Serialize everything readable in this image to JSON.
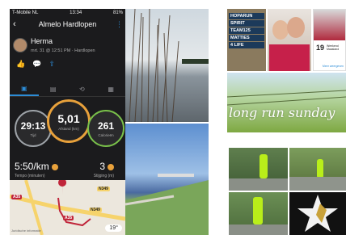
{
  "phone": {
    "status": {
      "carrier": "T-Mobile NL",
      "time": "13:34",
      "battery": "81%"
    },
    "title": "Almelo Hardlopen",
    "user": {
      "name": "Herma",
      "subtitle": "mrt. 31 @ 12:51 PM · Hardlopen"
    },
    "tabs": [
      {
        "label": "summary-tab"
      },
      {
        "label": "list-tab"
      },
      {
        "label": "loop-tab"
      },
      {
        "label": "chart-tab"
      }
    ],
    "stats": {
      "time": {
        "value": "29:13",
        "label": "Tijd"
      },
      "distance": {
        "value": "5,01",
        "label": "Afstand (km)"
      },
      "calories": {
        "value": "261",
        "label": "Calorieën"
      },
      "pace": {
        "value": "5:50/km",
        "label": "Tempo (minuten)"
      },
      "cadence": {
        "value": "3",
        "label": "Stijging (m)"
      }
    },
    "map": {
      "roads": [
        "A35",
        "N349",
        "N349",
        "A35"
      ],
      "temperature": "19°",
      "credit": "Juridische informatie"
    }
  },
  "collage": {
    "signs": [
      "HOPARUN",
      "SPIRIT",
      "TEAM125",
      "MATTIES",
      "4 LIFE"
    ],
    "card_number": "19",
    "card_title": "Weekend Maasland",
    "card_link": "Meer weergeven",
    "script_text": "long run sunday"
  },
  "colors": {
    "accent": "#2c8cd6",
    "distance_ring": "#e8a13b",
    "calorie_ring": "#79c04a",
    "time_ring": "#9ea3a8"
  }
}
